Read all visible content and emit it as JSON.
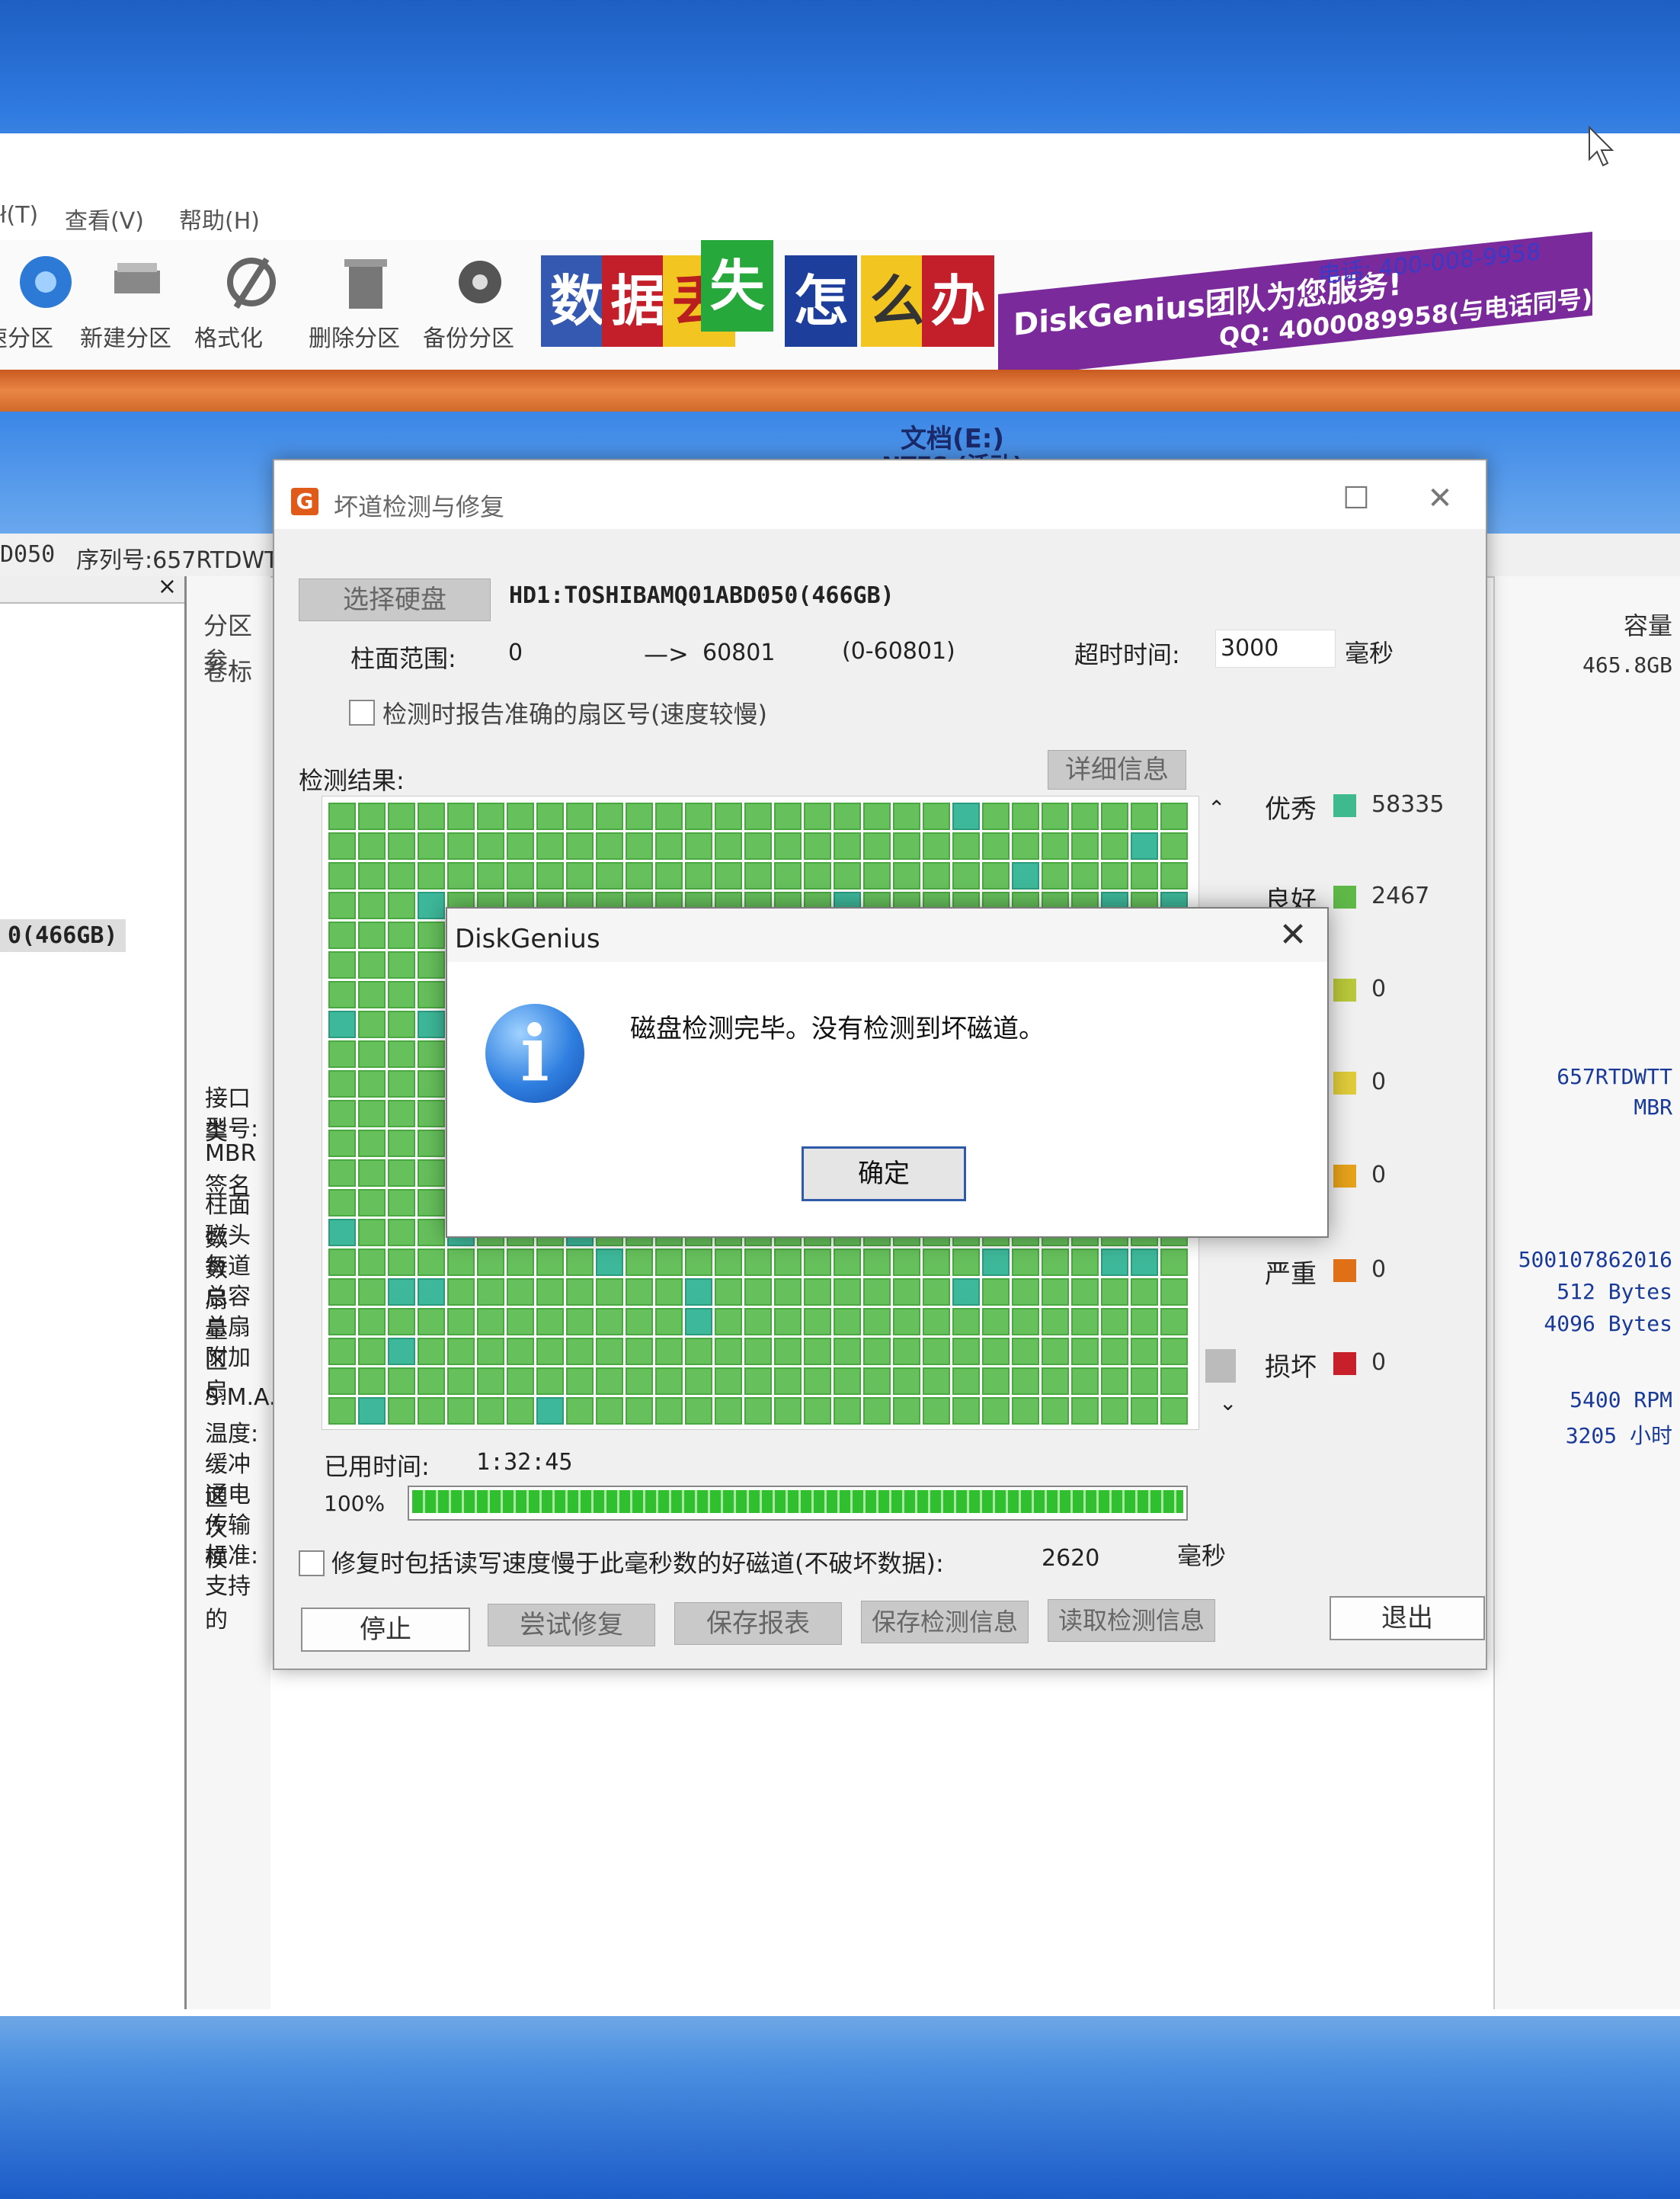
{
  "menu": {
    "tools_fragment": "ł(T)",
    "view": "查看(V)",
    "help": "帮助(H)"
  },
  "toolbar": {
    "quick_partition": "速分区",
    "new_partition": "新建分区",
    "format": "格式化",
    "delete_partition": "删除分区",
    "backup_partition": "备份分区"
  },
  "banner": {
    "chars": [
      "数",
      "据",
      "丢",
      "失",
      "怎",
      "么",
      "办"
    ],
    "team_text": "DiskGenius团队为您服务!",
    "phone": "电话: 400-008-9958",
    "qq": "QQ: 4000089958(与电话同号)"
  },
  "disk_partition": {
    "name": "文档(E:)",
    "fs": "NTFS (活动)"
  },
  "serial_row": {
    "model_tail": "D050",
    "serial_label": "序列号:657RTDWT"
  },
  "tree": {
    "disk_label": "0(466GB)"
  },
  "info_labels": [
    "接口类",
    "型号:",
    "MBR签名",
    "柱面数",
    "磁头数",
    "每道扇",
    "总容量",
    "总扇区",
    "附加扇",
    "S.M.A.",
    "温度:",
    "缓冲区",
    "通电次",
    "传输模",
    "标准:",
    "支持的"
  ],
  "partition_tab": {
    "label": "分区参",
    "col_label": "卷标"
  },
  "right_info": {
    "capacity_header": "容量",
    "capacity": "465.8GB",
    "serial": "657RTDWTT",
    "partition_type": "MBR",
    "total_bytes": "500107862016",
    "sector_size": "512 Bytes",
    "physical_sector": "4096 Bytes",
    "rpm": "5400 RPM",
    "power_on_hours": "3205 小时"
  },
  "scan_dialog": {
    "title": "坏道检测与修复",
    "select_disk_btn": "选择硬盘",
    "disk_name": "HD1:TOSHIBAMQ01ABD050(466GB)",
    "cylinder_label": "柱面范围:",
    "cylinder_from": "0",
    "arrow": "—>",
    "cylinder_to": "60801",
    "cylinder_range": "(0-60801)",
    "timeout_label": "超时时间:",
    "timeout_value": "3000",
    "timeout_unit": "毫秒",
    "report_sector_checkbox": "检测时报告准确的扇区号(速度较慢)",
    "result_label": "检测结果:",
    "details_btn": "详细信息",
    "legend": [
      {
        "name": "优秀",
        "count": "58335",
        "color": "#3fb98e"
      },
      {
        "name": "良好",
        "count": "2467",
        "color": "#5fb848"
      },
      {
        "name": "",
        "count": "0",
        "color": "#b9c83a"
      },
      {
        "name": "",
        "count": "0",
        "color": "#e0cc3a"
      },
      {
        "name": "",
        "count": "0",
        "color": "#e6a21a"
      },
      {
        "name": "严重",
        "count": "0",
        "color": "#e07018"
      },
      {
        "name": "损坏",
        "count": "0",
        "color": "#c8202a"
      }
    ],
    "elapsed_label": "已用时间:",
    "elapsed_value": "1:32:45",
    "progress_label": "100%",
    "progress_fraction": 1.0,
    "repair_checkbox": "修复时包括读写速度慢于此毫秒数的好磁道(不破坏数据):",
    "repair_ms_value": "2620",
    "repair_ms_unit": "毫秒",
    "stop_btn": "停止",
    "try_repair_btn": "尝试修复",
    "save_report_btn": "保存报表",
    "save_info_btn": "保存检测信息",
    "load_info_btn": "读取检测信息",
    "exit_btn": "退出"
  },
  "message_box": {
    "title": "DiskGenius",
    "message": "磁盘检测完毕。没有检测到坏磁道。",
    "ok_btn": "确定"
  }
}
